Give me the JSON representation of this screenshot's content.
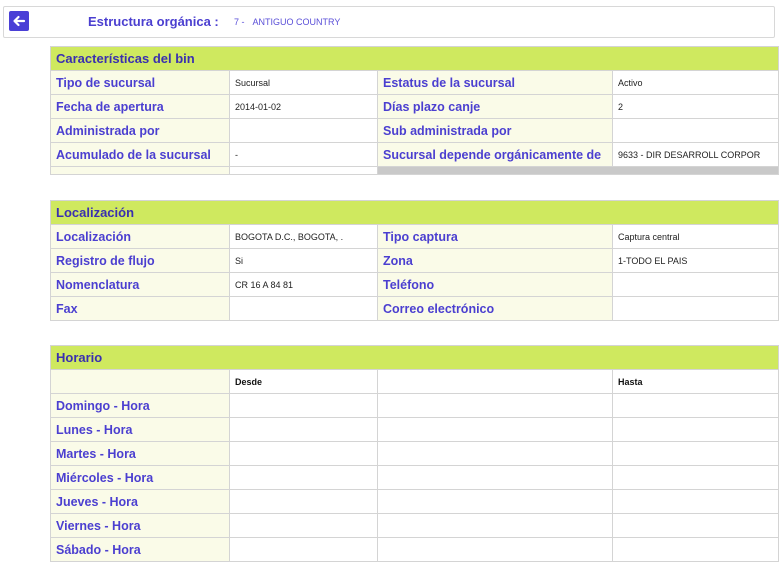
{
  "header": {
    "label": "Estructura orgánica :",
    "code": "7 -",
    "name": "ANTIGUO COUNTRY"
  },
  "caracteristicas": {
    "title": "Características del bin",
    "rows": [
      {
        "l1": "Tipo de sucursal",
        "v1": "Sucursal",
        "l2": "Estatus de la sucursal",
        "v2": "Activo"
      },
      {
        "l1": "Fecha de apertura",
        "v1": "2014-01-02",
        "l2": "Días plazo canje",
        "v2": "2"
      },
      {
        "l1": "Administrada por",
        "v1": "",
        "l2": "Sub administrada por",
        "v2": ""
      },
      {
        "l1": "Acumulado de la sucursal",
        "v1": "-",
        "l2": "Sucursal depende orgánicamente de",
        "v2": "9633 - DIR DESARROLL CORPOR"
      }
    ]
  },
  "localizacion": {
    "title": "Localización",
    "rows": [
      {
        "l1": "Localización",
        "v1": "BOGOTA D.C., BOGOTA, .",
        "l2": "Tipo captura",
        "v2": "Captura central"
      },
      {
        "l1": "Registro de flujo",
        "v1": "Si",
        "l2": "Zona",
        "v2": "1-TODO EL PAIS"
      },
      {
        "l1": "Nomenclatura",
        "v1": "CR 16 A 84 81",
        "l2": "Teléfono",
        "v2": ""
      },
      {
        "l1": "Fax",
        "v1": "",
        "l2": "Correo electrónico",
        "v2": ""
      }
    ]
  },
  "horario": {
    "title": "Horario",
    "col_desde": "Desde",
    "col_hasta": "Hasta",
    "days": [
      "Domingo - Hora",
      "Lunes - Hora",
      "Martes - Hora",
      "Miércoles - Hora",
      "Jueves - Hora",
      "Viernes - Hora",
      "Sábado - Hora"
    ]
  }
}
